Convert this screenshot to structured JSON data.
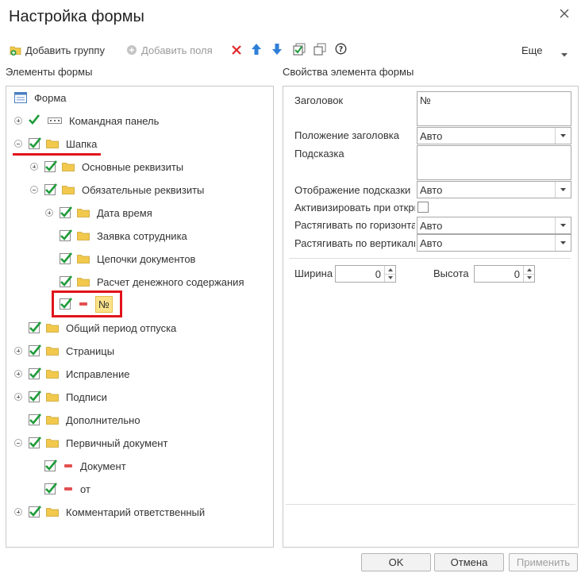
{
  "dialog": {
    "title": "Настройка формы"
  },
  "toolbar": {
    "add_group": "Добавить группу",
    "add_fields": "Добавить поля",
    "more": "Еще"
  },
  "left_panel": {
    "label": "Элементы формы"
  },
  "right_panel": {
    "label": "Свойства элемента формы"
  },
  "tree": [
    {
      "label": "Форма"
    },
    {
      "label": "Командная панель"
    },
    {
      "label": "Шапка"
    },
    {
      "label": "Основные реквизиты"
    },
    {
      "label": "Обязательные реквизиты"
    },
    {
      "label": "Дата время"
    },
    {
      "label": "Заявка сотрудника"
    },
    {
      "label": "Цепочки документов"
    },
    {
      "label": "Расчет денежного содержания"
    },
    {
      "label": "№"
    },
    {
      "label": "Общий период отпуска"
    },
    {
      "label": "Страницы"
    },
    {
      "label": "Исправление"
    },
    {
      "label": "Подписи"
    },
    {
      "label": "Дополнительно"
    },
    {
      "label": "Первичный документ"
    },
    {
      "label": "Документ"
    },
    {
      "label": "от"
    },
    {
      "label": "Комментарий ответственный"
    }
  ],
  "props": {
    "header_label": "Заголовок",
    "header_value": "№",
    "header_position_label": "Положение заголовка",
    "header_position_value": "Авто",
    "tooltip_label": "Подсказка",
    "tooltip_value": "",
    "tooltip_display_label": "Отображение подсказки",
    "tooltip_display_value": "Авто",
    "activate_label": "Активизировать при открытии",
    "stretch_h_label": "Растягивать по горизонтали",
    "stretch_h_value": "Авто",
    "stretch_v_label": "Растягивать по вертикали",
    "stretch_v_value": "Авто",
    "width_label": "Ширина",
    "width_value": "0",
    "height_label": "Высота",
    "height_value": "0"
  },
  "buttons": {
    "ok": "OK",
    "cancel": "Отмена",
    "apply": "Применить"
  },
  "colors": {
    "check_green": "#1f9c3a",
    "folder_yellow": "#f2c94c",
    "highlight_red": "#e0141c",
    "selected_bg": "#fbe38a"
  }
}
